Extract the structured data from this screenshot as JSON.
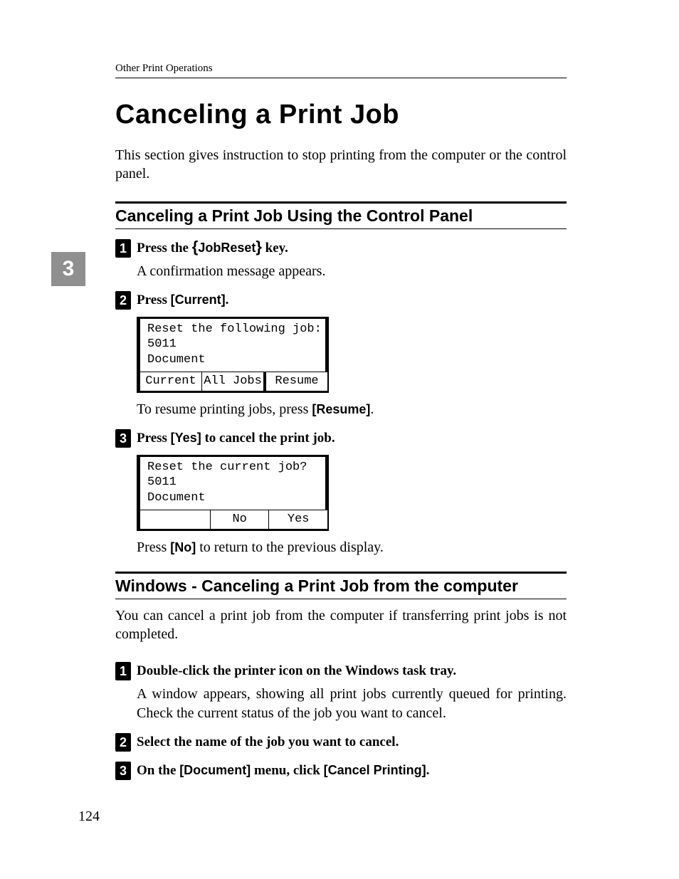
{
  "chapter_tab": "3",
  "page_number": "124",
  "running_head": "Other Print Operations",
  "title": "Canceling a Print Job",
  "intro": "This section gives instruction to stop printing from the computer or the control panel.",
  "section1": {
    "heading": "Canceling a Print Job Using the Control Panel",
    "step1": {
      "num": "1",
      "prefix": "Press the ",
      "key": "JobReset",
      "suffix": " key.",
      "body": "A confirmation message appears."
    },
    "step2": {
      "num": "2",
      "prefix": "Press ",
      "btn": "[Current]",
      "suffix": ".",
      "lcd_lines": "Reset the following job:\n5011\nDocument",
      "lcd_buttons": {
        "a": "Current",
        "b": "All Jobs",
        "c": "Resume"
      },
      "after_a": "To resume printing jobs, press ",
      "after_btn": "[Resume]",
      "after_b": "."
    },
    "step3": {
      "num": "3",
      "prefix": "Press ",
      "btn": "[Yes]",
      "suffix": " to cancel the print job.",
      "lcd_lines": "Reset the current job?\n5011\nDocument",
      "lcd_buttons": {
        "no": "No",
        "yes": "Yes"
      },
      "after_a": "Press ",
      "after_btn": "[No]",
      "after_b": " to return to the previous display."
    }
  },
  "section2": {
    "heading": "Windows - Canceling a Print Job from the computer",
    "intro": "You can cancel a print job from the computer if transferring print jobs is not completed.",
    "step1": {
      "num": "1",
      "text": "Double-click the printer icon on the Windows task tray.",
      "body": "A window appears, showing all print jobs currently queued for printing. Check the current status of the job you want to cancel."
    },
    "step2": {
      "num": "2",
      "text": "Select the name of the job you want to cancel."
    },
    "step3": {
      "num": "3",
      "a": "On the ",
      "btn1": "[Document]",
      "b": " menu, click ",
      "btn2": "[Cancel Printing]",
      "c": "."
    }
  }
}
